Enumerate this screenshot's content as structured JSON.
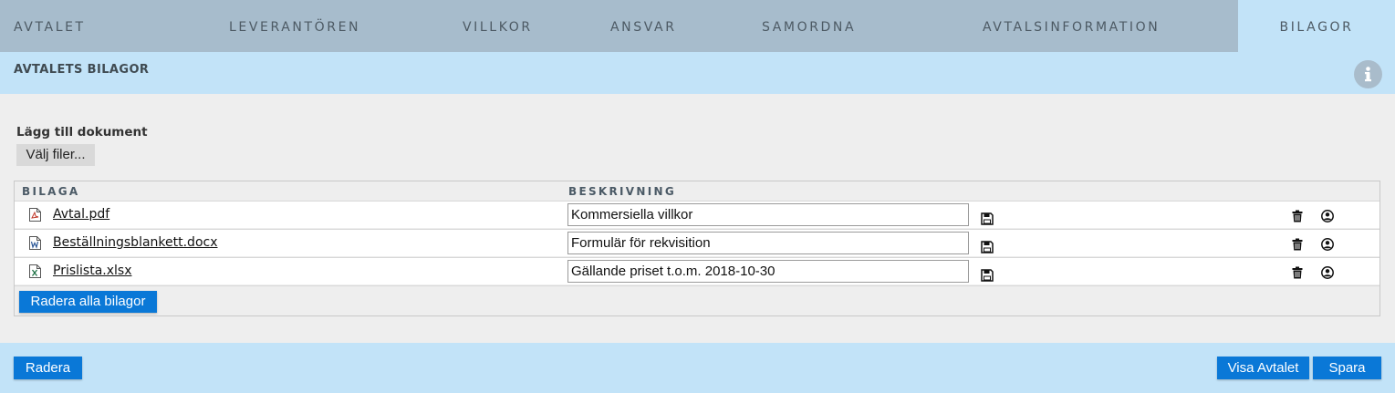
{
  "tabs": [
    {
      "label": "AVTALET"
    },
    {
      "label": "LEVERANTÖREN"
    },
    {
      "label": "VILLKOR"
    },
    {
      "label": "ANSVAR"
    },
    {
      "label": "SAMORDNA"
    },
    {
      "label": "AVTALSINFORMATION"
    },
    {
      "label": "BILAGOR",
      "active": true
    }
  ],
  "section": {
    "title": "AVTALETS BILAGOR",
    "icon": "info-icon"
  },
  "upload": {
    "label": "Lägg till dokument",
    "button": "Välj filer..."
  },
  "table": {
    "headers": {
      "attachment": "BILAGA",
      "description": "BESKRIVNING"
    },
    "rows": [
      {
        "file": "Avtal.pdf",
        "icon": "pdf-file-icon",
        "description": "Kommersiella villkor"
      },
      {
        "file": "Beställningsblankett.docx",
        "icon": "word-file-icon",
        "description": "Formulär för rekvisition"
      },
      {
        "file": "Prislista.xlsx",
        "icon": "excel-file-icon",
        "description": "Gällande priset t.o.m. 2018-10-30"
      }
    ],
    "delete_all": "Radera alla bilagor"
  },
  "footer": {
    "delete": "Radera",
    "show": "Visa Avtalet",
    "save": "Spara"
  },
  "colors": {
    "tab_bar": "#a7bccc",
    "light_blue": "#c2e3f8",
    "button_blue": "#0a78d7",
    "panel": "#eeeeee"
  }
}
